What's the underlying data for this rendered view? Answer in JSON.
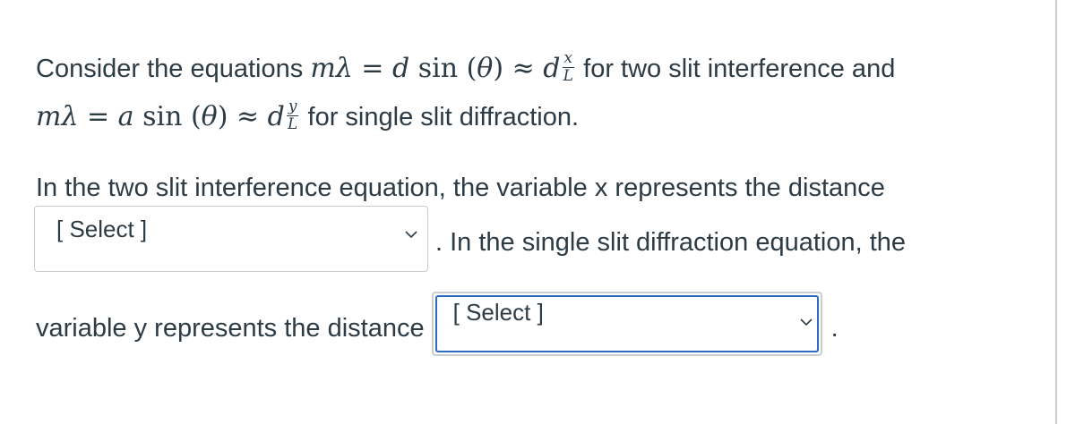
{
  "question": {
    "intro_prefix": "Consider the equations ",
    "eq1_lhs": "mλ = ",
    "eq1_d": "d",
    "eq1_sin": " sin (",
    "eq1_theta": "θ",
    "eq1_close": ") ≈ ",
    "eq1_d2": "d",
    "eq1_frac_num": "x",
    "eq1_frac_den": "L",
    "intro_mid": " for two slit interference and",
    "eq2_lhs": "mλ = ",
    "eq2_a": "a",
    "eq2_sin": " sin (",
    "eq2_theta": "θ",
    "eq2_close": ") ≈ ",
    "eq2_d2": "d",
    "eq2_frac_num": "y",
    "eq2_frac_den": "L",
    "intro_end": " for single slit diffraction.",
    "part1_text": "In the two slit interference equation, the variable x represents the distance",
    "part1_after": ". In the single slit diffraction equation, the",
    "part2_text": "variable y represents the distance",
    "part2_end": "."
  },
  "dropdowns": {
    "select1": {
      "selected": "[ Select ]",
      "focused": false
    },
    "select2": {
      "selected": "[ Select ]",
      "focused": true
    }
  },
  "colors": {
    "text": "#2d3b45",
    "border": "#c7cdd1",
    "focus": "#2b6bc0"
  },
  "icons": {
    "select1_chevron": "chevron-down-icon",
    "select2_chevron": "chevron-down-icon"
  }
}
